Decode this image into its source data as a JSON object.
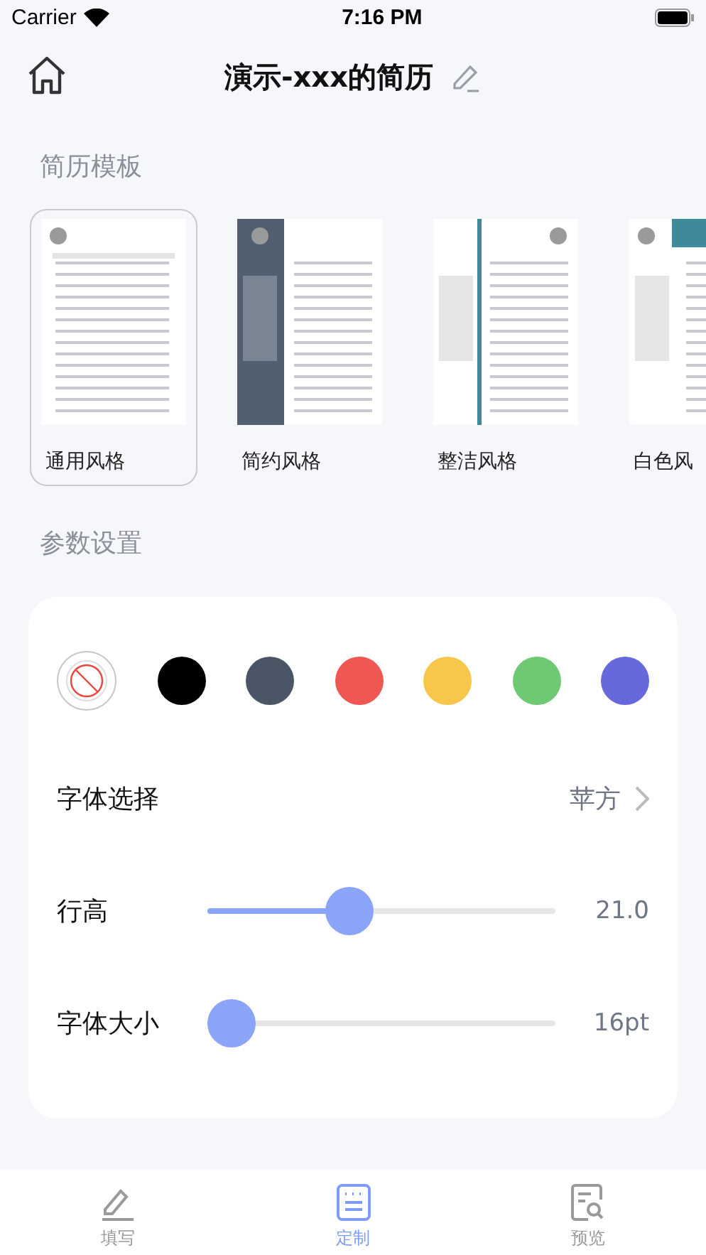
{
  "status_bar": {
    "carrier": "Carrier",
    "time": "7:16 PM"
  },
  "nav": {
    "title": "演示-xxx的简历"
  },
  "templates_section": {
    "title": "简历模板",
    "items": [
      {
        "label": "通用风格",
        "selected": true
      },
      {
        "label": "简约风格",
        "selected": false
      },
      {
        "label": "整洁风格",
        "selected": false
      },
      {
        "label": "白色风",
        "selected": false
      }
    ]
  },
  "params_section": {
    "title": "参数设置",
    "colors": [
      {
        "kind": "none",
        "selected": true
      },
      {
        "kind": "swatch",
        "color": "#000000",
        "selected": false
      },
      {
        "kind": "swatch",
        "color": "#4a5665",
        "selected": false
      },
      {
        "kind": "swatch",
        "color": "#ef5753",
        "selected": false
      },
      {
        "kind": "swatch",
        "color": "#f7c64a",
        "selected": false
      },
      {
        "kind": "swatch",
        "color": "#6fc872",
        "selected": false
      },
      {
        "kind": "swatch",
        "color": "#6668db",
        "selected": false
      }
    ],
    "font": {
      "label": "字体选择",
      "value": "苹方"
    },
    "sliders": [
      {
        "label": "行高",
        "level": 0.41,
        "reading": "21.0"
      },
      {
        "label": "字体大小",
        "level": 0.07,
        "reading": "16pt"
      }
    ]
  },
  "tab_bar": [
    {
      "label": "填写",
      "kind": "edit",
      "selected": false
    },
    {
      "label": "定制",
      "kind": "custom",
      "selected": true
    },
    {
      "label": "预览",
      "kind": "preview",
      "selected": false
    }
  ]
}
